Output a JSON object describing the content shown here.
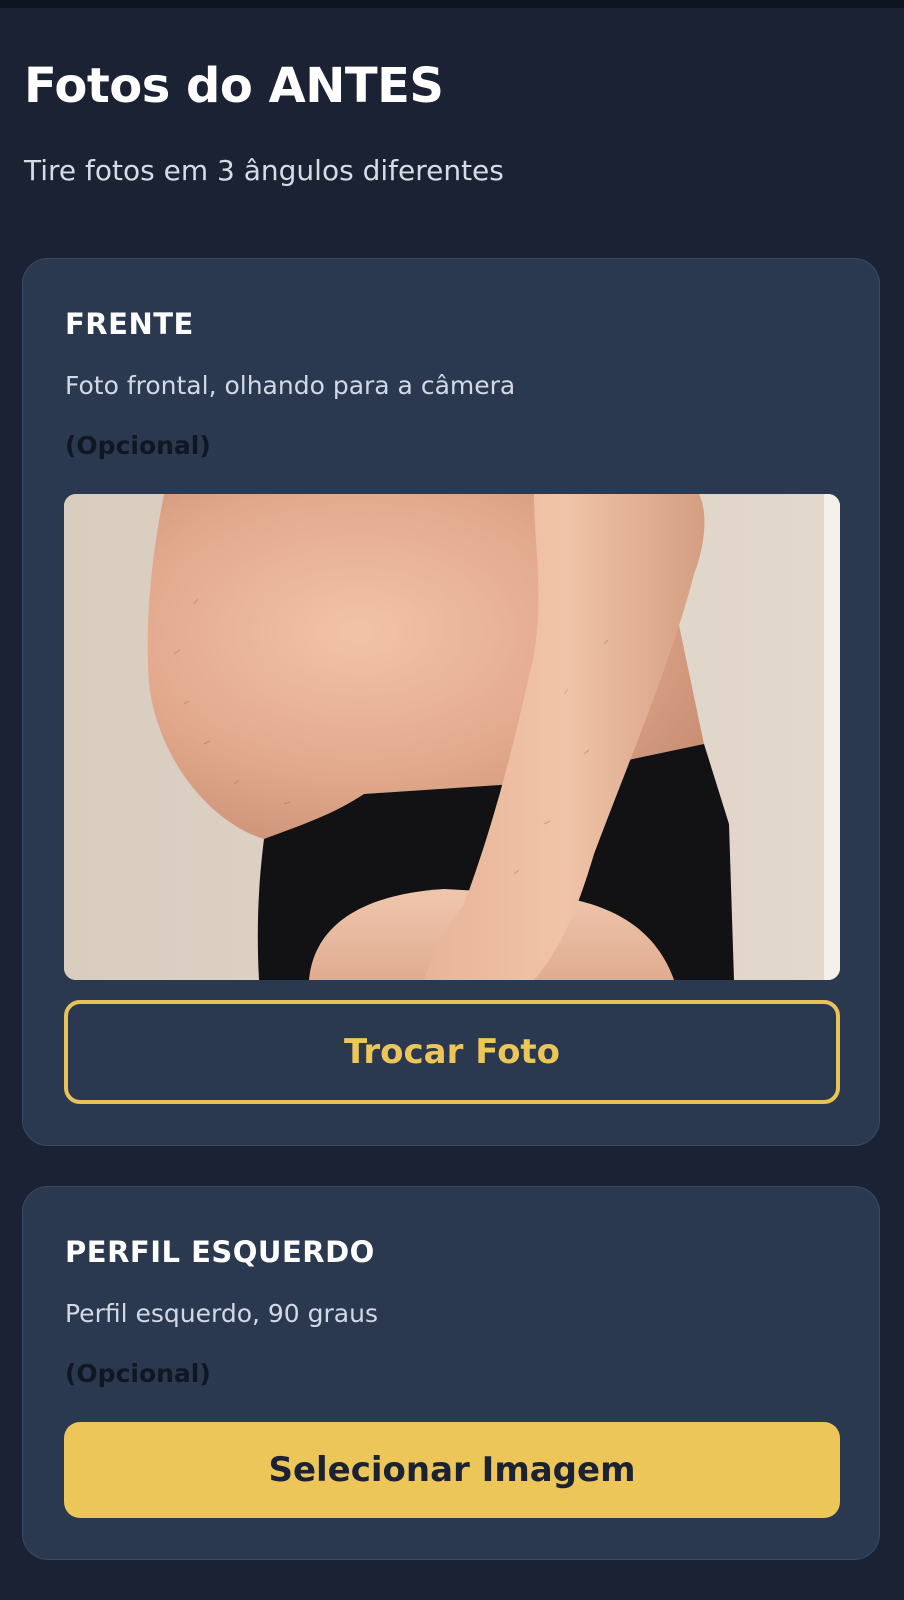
{
  "header": {
    "title": "Fotos do ANTES",
    "subtitle": "Tire fotos em 3 ângulos diferentes"
  },
  "cards": [
    {
      "title": "FRENTE",
      "description": "Foto frontal, olhando para a câmera",
      "optional": "(Opcional)",
      "has_photo": true,
      "button_label": "Trocar Foto"
    },
    {
      "title": "PERFIL ESQUERDO",
      "description": "Perfil esquerdo, 90 graus",
      "optional": "(Opcional)",
      "has_photo": false,
      "button_label": "Selecionar Imagem"
    }
  ],
  "colors": {
    "background": "#1a2233",
    "card": "#2b3950",
    "accent": "#ecc659",
    "text_primary": "#ffffff",
    "text_secondary": "#d3d9e4"
  }
}
